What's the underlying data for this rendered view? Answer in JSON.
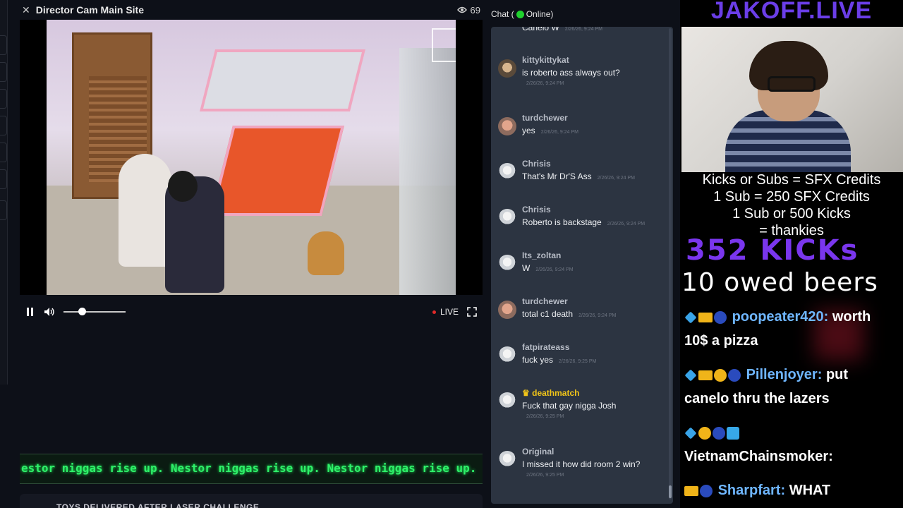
{
  "player": {
    "title": "Director Cam Main Site",
    "viewer_count": "69",
    "live_label": "LIVE",
    "volume_level": 0.3
  },
  "ticker": {
    "text": "estor niggas rise up. Nestor niggas rise up. Nestor niggas rise up."
  },
  "banner": {
    "text": "TOYS DELIVERED AFTER LASER CHALLENGE"
  },
  "chat": {
    "header_prefix": "Chat (",
    "header_status": "Online)",
    "partial_top": "Canelo W",
    "partial_top_time": "2/26/26, 9:24 PM",
    "messages": [
      {
        "user": "kittykittykat",
        "text": "is roberto ass always out?",
        "time": "2/26/26, 9:24 PM",
        "avatar": "photo-a"
      },
      {
        "user": "turdchewer",
        "text": "yes",
        "time": "2/26/26, 9:24 PM",
        "avatar": "photo-b"
      },
      {
        "user": "Chrisis",
        "text": "That's Mr Dr'S Ass",
        "time": "2/26/26, 9:24 PM",
        "avatar": "ghost"
      },
      {
        "user": "Chrisis",
        "text": "Roberto is backstage",
        "time": "2/26/26, 9:24 PM",
        "avatar": "ghost"
      },
      {
        "user": "Its_zoltan",
        "text": "W",
        "time": "2/26/26, 9:24 PM",
        "avatar": "ghost"
      },
      {
        "user": "turdchewer",
        "text": "total c1 death",
        "time": "2/26/26, 9:24 PM",
        "avatar": "photo-b"
      },
      {
        "user": "fatpirateass",
        "text": "fuck yes",
        "time": "2/26/26, 9:25 PM",
        "avatar": "ghost"
      },
      {
        "user": "deathmatch",
        "text": "Fuck that gay nigga Josh",
        "time": "2/26/26, 9:25 PM",
        "avatar": "ghost",
        "crown": "♛"
      },
      {
        "user": "Original",
        "text": "I missed it how did room 2 win?",
        "time": "2/26/26, 9:25 PM",
        "avatar": "ghost"
      }
    ]
  },
  "overlay": {
    "brand": "JAKOFF.LIVE",
    "info_lines": [
      "Kicks or Subs = SFX Credits",
      "1 Sub = 250 SFX Credits",
      "1 Sub or 500 Kicks",
      "= thankies"
    ],
    "kicks": "352 KICKs",
    "beers": "10 owed beers",
    "messages": [
      {
        "user": "poopeater420:",
        "text_inline": "worth",
        "text_next": "10$ a pizza"
      },
      {
        "user": "Pillenjoyer:",
        "text_inline": "put",
        "text_next": "canelo thru the lazers"
      },
      {
        "user": "VietnamChainsmoker:",
        "text_inline": "",
        "text_next": ""
      },
      {
        "user": "Sharpfart:",
        "text_inline": "WHAT",
        "text_next": ""
      }
    ]
  },
  "colors": {
    "online": "#1fd12e",
    "live_dot": "#e12a2a",
    "ticker_green": "#2ff06a",
    "brand_purple": "#6b3ee8",
    "crown_gold": "#f0c419",
    "chat_bg": "#2c3441"
  },
  "icons": [
    "close-icon",
    "eye-icon",
    "pause-icon",
    "volume-icon",
    "fullscreen-icon",
    "crown-icon"
  ]
}
